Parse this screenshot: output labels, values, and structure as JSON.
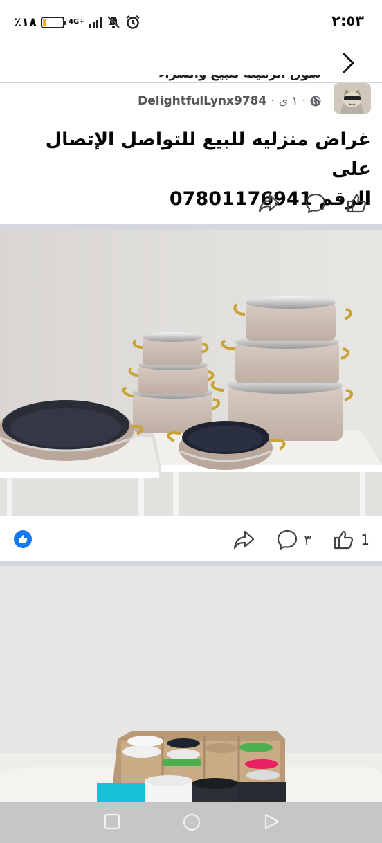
{
  "status_bar": {
    "time": "٢:٥٣",
    "battery_percent": "٪١٨",
    "network": "4G+",
    "icons": [
      "alarm-icon",
      "mute-icon",
      "signal-icon",
      "battery-icon"
    ]
  },
  "post": {
    "group_name": "سوق الرميلة للبيع والشراء",
    "username": "DelightfulLynx9784",
    "time_ago": "١ ي",
    "privacy_icon": "globe-icon",
    "text_line1": "غراض منزليه للبيع للتواصل الإتصال على",
    "text_line2": "الرقم 07801176941"
  },
  "actions_top": {
    "icons": [
      "like-icon",
      "comment-icon",
      "share-icon"
    ]
  },
  "actions_photo1": {
    "like_count": "1",
    "comment_count": "٣",
    "reaction_icon": "like-reaction-icon"
  },
  "colors": {
    "facebook_blue": "#1877f2",
    "separator": "#d4d7dc",
    "nav_bar": "#c6c6c6"
  },
  "nav_bar": {
    "icons": [
      "recents-square-icon",
      "home-circle-icon",
      "back-triangle-icon"
    ]
  }
}
